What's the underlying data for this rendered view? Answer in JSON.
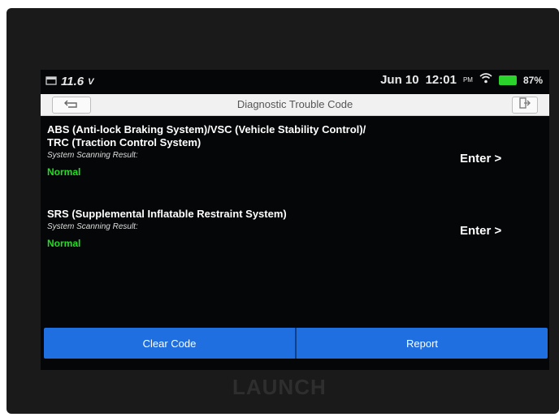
{
  "status": {
    "voltage": "11.6",
    "voltage_unit": "V",
    "date": "Jun 10",
    "time": "12:01",
    "ampm": "PM",
    "battery": "87%"
  },
  "header": {
    "title": "Diagnostic Trouble Code"
  },
  "systems": [
    {
      "name_line1": "ABS (Anti-lock Braking System)/VSC (Vehicle Stability Control)/",
      "name_line2": "TRC (Traction Control System)",
      "scan_label": "System Scanning Result:",
      "scan_value": "Normal",
      "enter_label": "Enter >"
    },
    {
      "name_line1": "SRS (Supplemental Inflatable Restraint System)",
      "scan_label": "System Scanning Result:",
      "scan_value": "Normal",
      "enter_label": "Enter >"
    }
  ],
  "footer": {
    "clear_code_label": "Clear Code",
    "report_label": "Report"
  },
  "device": {
    "brand": "LAUNCH"
  },
  "colors": {
    "screen_bg": "#050607",
    "accent_blue": "#1f6fe0",
    "normal_green": "#22dd22",
    "battery_green": "#2bd42b"
  }
}
